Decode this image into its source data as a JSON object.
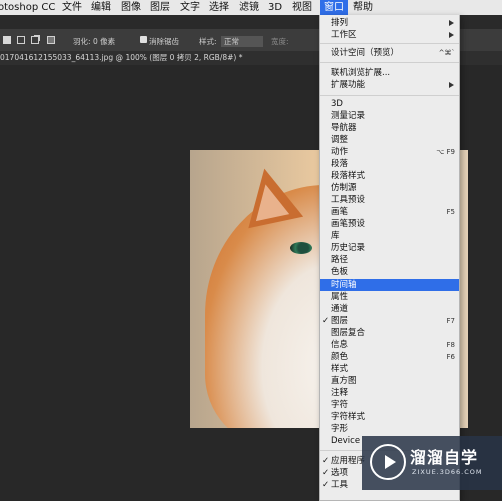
{
  "menubar": {
    "items": [
      {
        "label": "otoshop CC"
      },
      {
        "label": "文件"
      },
      {
        "label": "编辑"
      },
      {
        "label": "图像"
      },
      {
        "label": "图层"
      },
      {
        "label": "文字"
      },
      {
        "label": "选择"
      },
      {
        "label": "滤镜"
      },
      {
        "label": "3D"
      },
      {
        "label": "视图"
      },
      {
        "label": "窗口"
      },
      {
        "label": "帮助"
      }
    ],
    "active_index": 10,
    "accent": "#2f6ee8"
  },
  "options_bar": {
    "feather_label": "羽化:",
    "feather_value": "0 像素",
    "antialias_label": "消除锯齿",
    "style_label": "样式:",
    "style_value": "正常",
    "width_label": "宽度:"
  },
  "document_tab": {
    "title": "0170416121550​33_64113.jpg @ 100% (图层 0 拷贝 2, RGB/8#) *"
  },
  "window_menu": {
    "items": [
      {
        "label": "排列",
        "submenu": true
      },
      {
        "label": "工作区",
        "submenu": true
      },
      {
        "label": "设计空间（预览）",
        "shortcut": "^⌘`"
      },
      {
        "label": "联机浏览扩展..."
      },
      {
        "label": "扩展功能",
        "submenu": true
      },
      {
        "label": "3D"
      },
      {
        "label": "测量记录"
      },
      {
        "label": "导航器"
      },
      {
        "label": "调整"
      },
      {
        "label": "动作",
        "shortcut": "⌥ F9"
      },
      {
        "label": "段落"
      },
      {
        "label": "段落样式"
      },
      {
        "label": "仿制源"
      },
      {
        "label": "工具预设"
      },
      {
        "label": "画笔",
        "shortcut": "F5"
      },
      {
        "label": "画笔预设"
      },
      {
        "label": "库"
      },
      {
        "label": "历史记录"
      },
      {
        "label": "路径"
      },
      {
        "label": "色板"
      },
      {
        "label": "时间轴",
        "highlighted": true
      },
      {
        "label": "属性"
      },
      {
        "label": "通道"
      },
      {
        "label": "图层",
        "checked": true,
        "shortcut": "F7"
      },
      {
        "label": "图层复合"
      },
      {
        "label": "信息",
        "shortcut": "F8"
      },
      {
        "label": "颜色",
        "shortcut": "F6"
      },
      {
        "label": "样式"
      },
      {
        "label": "直方图"
      },
      {
        "label": "注释"
      },
      {
        "label": "字符"
      },
      {
        "label": "字符样式"
      },
      {
        "label": "字形"
      },
      {
        "label": "Device"
      },
      {
        "label": "应用程序",
        "checked": true
      },
      {
        "label": "选项",
        "checked": true
      },
      {
        "label": "工具",
        "checked": true
      }
    ]
  },
  "watermark": {
    "title": "溜溜自学",
    "subtitle": "ZIXUE.3D66.COM"
  },
  "icons": [
    "tool-preset-icon",
    "selection-mode-icons",
    "checkmark-icon",
    "submenu-arrow-icon",
    "play-logo-icon"
  ]
}
